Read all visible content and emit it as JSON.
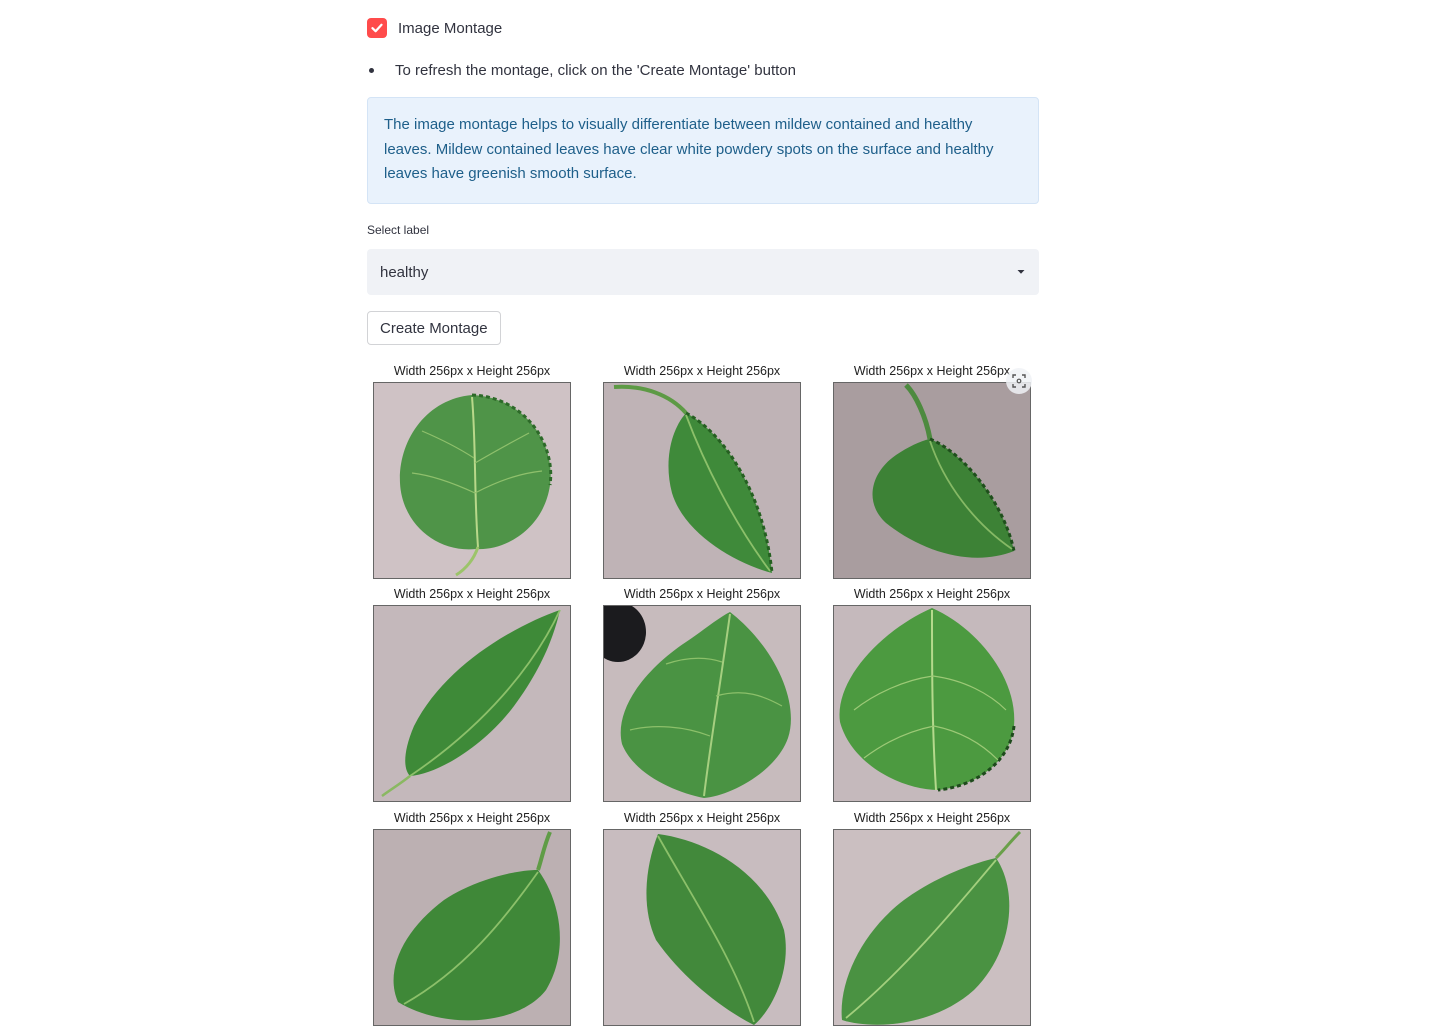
{
  "checkbox": {
    "label": "Image Montage",
    "checked": true,
    "color": "#ff4b4b"
  },
  "note": "To refresh the montage, click on the 'Create Montage' button",
  "info": "The image montage helps to visually differentiate between mildew contained and healthy leaves. Mildew contained leaves have clear white powdery spots on the surface and healthy leaves have greenish smooth surface.",
  "select": {
    "label": "Select label",
    "value": "healthy"
  },
  "button": {
    "label": "Create Montage"
  },
  "montage": {
    "items": [
      {
        "title": "Width 256px x Height 256px"
      },
      {
        "title": "Width 256px x Height 256px"
      },
      {
        "title": "Width 256px x Height 256px"
      },
      {
        "title": "Width 256px x Height 256px"
      },
      {
        "title": "Width 256px x Height 256px"
      },
      {
        "title": "Width 256px x Height 256px"
      },
      {
        "title": "Width 256px x Height 256px"
      },
      {
        "title": "Width 256px x Height 256px"
      },
      {
        "title": "Width 256px x Height 256px"
      }
    ]
  },
  "icons": {
    "checkbox": "check-icon",
    "dropdown": "caret-down-icon",
    "expand": "fullscreen-icon"
  },
  "colors": {
    "accent": "#ff4b4b",
    "info_bg": "#e9f2fc",
    "info_text": "#1e5f8a",
    "select_bg": "#f0f2f6",
    "leaf": "#3f8a3a",
    "background_tile": "#c9bcc0"
  }
}
